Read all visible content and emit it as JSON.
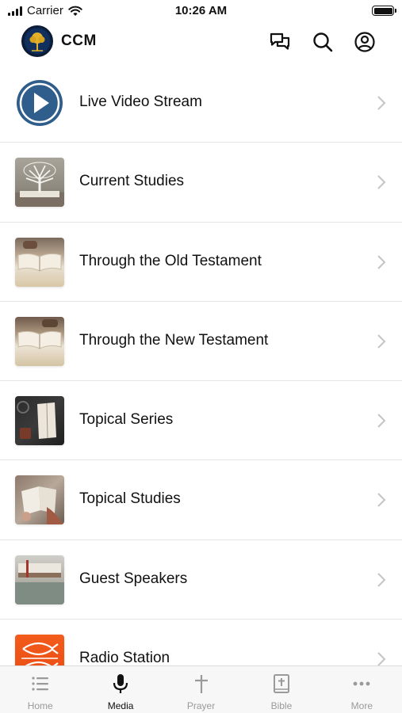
{
  "status_bar": {
    "carrier": "Carrier",
    "time": "10:26 AM",
    "battery_level": 1.0
  },
  "header": {
    "title": "CCM",
    "icons": [
      "logo-icon",
      "chat-icon",
      "search-icon",
      "account-icon"
    ]
  },
  "menu": {
    "items": [
      {
        "label": "Live Video Stream",
        "thumbnail": "play-icon"
      },
      {
        "label": "Current Studies",
        "thumbnail": "tree-photo"
      },
      {
        "label": "Through the Old Testament",
        "thumbnail": "open-bible-photo"
      },
      {
        "label": "Through the New Testament",
        "thumbnail": "open-bible-photo"
      },
      {
        "label": "Topical Series",
        "thumbnail": "bible-on-desk-photo"
      },
      {
        "label": "Topical Studies",
        "thumbnail": "reading-bible-photo"
      },
      {
        "label": "Guest Speakers",
        "thumbnail": "bible-stack-photo"
      },
      {
        "label": "Radio Station",
        "thumbnail": "fish-logo"
      }
    ]
  },
  "tab_bar": {
    "tabs": [
      {
        "label": "Home",
        "icon": "list-icon",
        "active": false
      },
      {
        "label": "Media",
        "icon": "microphone-icon",
        "active": true
      },
      {
        "label": "Prayer",
        "icon": "cross-icon",
        "active": false
      },
      {
        "label": "Bible",
        "icon": "bible-icon",
        "active": false
      },
      {
        "label": "More",
        "icon": "ellipsis-icon",
        "active": false
      }
    ]
  },
  "colors": {
    "live_icon": "#2f5d8c",
    "radio_bg": "#f25c1c",
    "active_tab": "#111111",
    "inactive_tab": "#9a9a9a"
  }
}
